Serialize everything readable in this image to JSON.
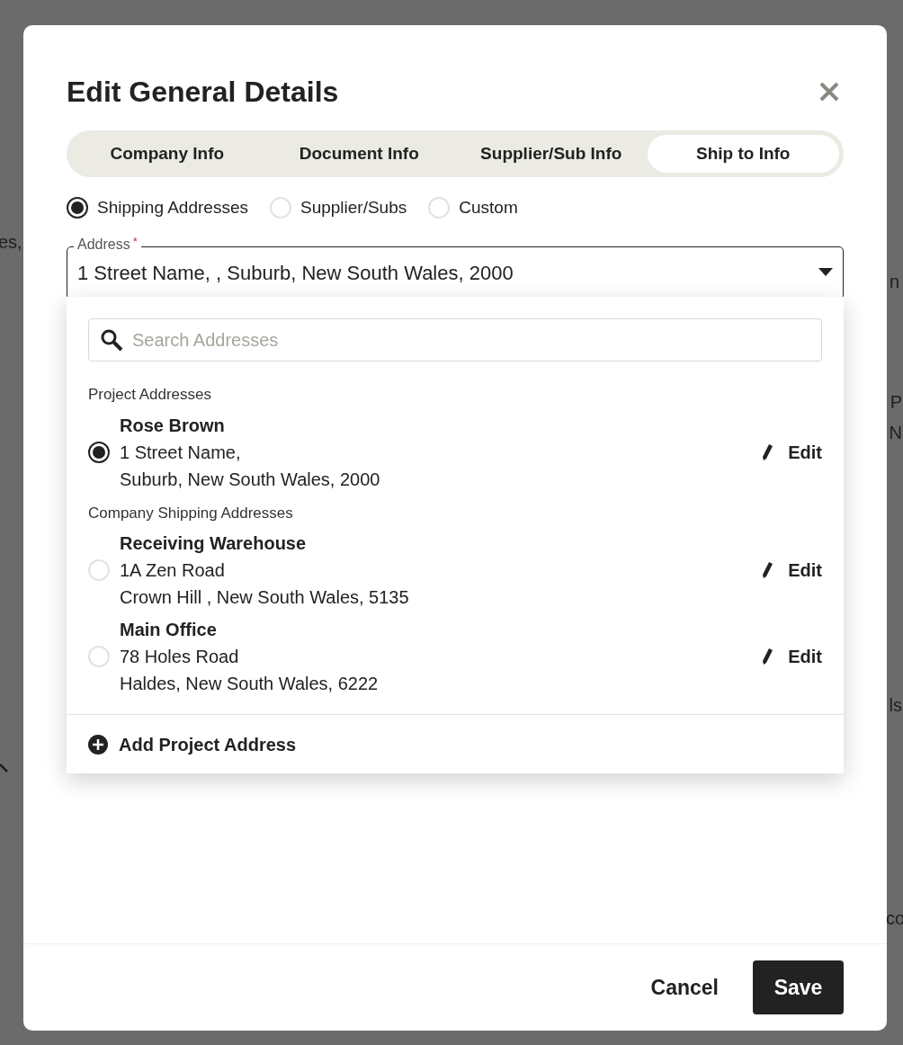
{
  "backdrop": [
    {
      "text": "es,"
    },
    {
      "text": "n"
    },
    {
      "text": "P"
    },
    {
      "text": "N"
    },
    {
      "text": "ls"
    },
    {
      "text": "co"
    }
  ],
  "dialog": {
    "title": "Edit General Details",
    "tabs": [
      {
        "label": "Company Info",
        "selected": false
      },
      {
        "label": "Document Info",
        "selected": false
      },
      {
        "label": "Supplier/Sub Info",
        "selected": false
      },
      {
        "label": "Ship to Info",
        "selected": true
      }
    ],
    "address_types": [
      {
        "label": "Shipping Addresses",
        "selected": true
      },
      {
        "label": "Supplier/Subs",
        "selected": false
      },
      {
        "label": "Custom",
        "selected": false
      }
    ],
    "address_field": {
      "label": "Address",
      "required_mark": "*",
      "value": "1 Street Name, , Suburb, New South Wales, 2000",
      "expanded": true
    },
    "dropdown": {
      "search": {
        "placeholder": "Search Addresses"
      },
      "groups": [
        {
          "label": "Project Addresses",
          "items": [
            {
              "name": "Rose Brown",
              "lines": [
                "1 Street Name,",
                "Suburb, New South Wales, 2000"
              ],
              "selected": true,
              "action": "Edit"
            }
          ]
        },
        {
          "label": "Company Shipping Addresses",
          "items": [
            {
              "name": "Receiving Warehouse",
              "lines": [
                "1A Zen Road",
                "Crown Hill , New South Wales, 5135"
              ],
              "selected": false,
              "action": "Edit"
            },
            {
              "name": "Main Office",
              "lines": [
                "78 Holes Road",
                "Haldes, New South Wales, 6222"
              ],
              "selected": false,
              "action": "Edit"
            }
          ]
        }
      ],
      "add_button": "Add Project Address"
    },
    "buttons": {
      "cancel": "Cancel",
      "save": "Save"
    }
  }
}
